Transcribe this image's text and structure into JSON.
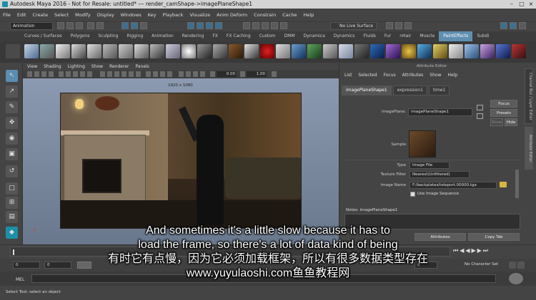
{
  "window": {
    "title": "Autodesk Maya 2016 - Not for Resale: untitled*   ---   render_camShape->imagePlaneShape1"
  },
  "menubar": [
    "File",
    "Edit",
    "Create",
    "Select",
    "Modify",
    "Display",
    "Windows",
    "Key",
    "Playback",
    "Visualize",
    "Anim Deform",
    "Constrain",
    "Cache",
    "Help"
  ],
  "statusline": {
    "mode": "Animation",
    "live_surface": "No Live Surface"
  },
  "shelf_tabs": [
    "Curves / Surfaces",
    "Polygons",
    "Sculpting",
    "Rigging",
    "Animation",
    "Rendering",
    "FX",
    "FX Caching",
    "Custom",
    "DMM",
    "Dynamica",
    "Dynamics",
    "Fluids",
    "Fur",
    "nHair",
    "Muscle",
    "PaintEffects",
    "Subdi"
  ],
  "shelf_active": "PaintEffects",
  "panel_menu": [
    "View",
    "Shading",
    "Lighting",
    "Show",
    "Renderer",
    "Panels"
  ],
  "panel_values": {
    "a": "0.00",
    "b": "1.00"
  },
  "resolution": "1920 x 1080",
  "attribute_editor": {
    "header": "Attribute Editor",
    "menu": [
      "List",
      "Selected",
      "Focus",
      "Attributes",
      "Show",
      "Help"
    ],
    "tabs": [
      "imagePlaneShape1",
      "expression1",
      "time1"
    ],
    "image_plane_label": "imagePlane:",
    "image_plane_value": "imagePlaneShape1",
    "focus": "Focus",
    "presets": "Presets",
    "show": "Show",
    "hide": "Hide",
    "sample_label": "Sample",
    "type_label": "Type",
    "type_value": "Image File",
    "texture_filter_label": "Texture Filter",
    "texture_filter_value": "Nearest(Unfiltered)",
    "image_name_label": "Image Name",
    "image_name_value": "F:/backplates/teleport.00000.tga",
    "use_image_sequence": "Use Image Sequence",
    "notes_label": "Notes: imagePlaneShape1",
    "bottom_buttons": [
      "Attributes",
      "Copy Tab"
    ],
    "side_tabs": [
      "Channel Box / Layer Editor",
      "Attribute Editor"
    ]
  },
  "time": {
    "frame": "0",
    "start": "0",
    "end": "0",
    "no_character_set": "No Character Set"
  },
  "mel": "MEL",
  "help_line": "Select Tool: select an object",
  "subtitles": [
    "And sometimes it's a little slow because it has to",
    "load the frame, so there's a lot of data kind of being",
    "有时它有点慢，因为它必须加载框架，所以有很多数据类型存在",
    "www.yuyulaoshi.com鱼鱼教程网"
  ]
}
